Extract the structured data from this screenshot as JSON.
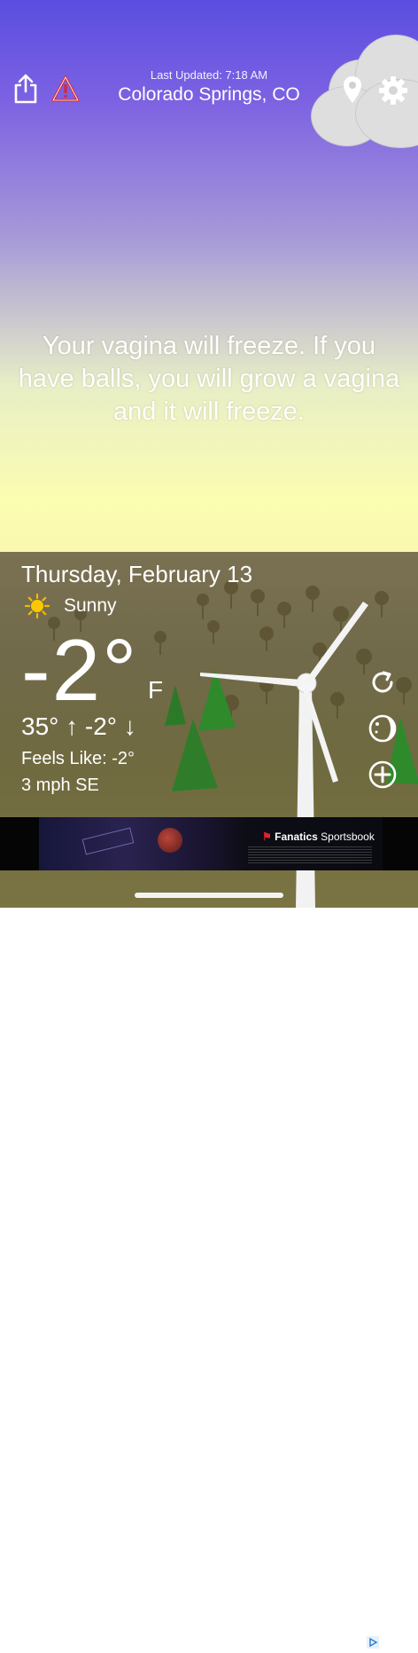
{
  "header": {
    "last_updated": "Last Updated: 7:18 AM",
    "location": "Colorado Springs, CO"
  },
  "icons": {
    "share": "share-icon",
    "alert": "alert-icon",
    "location": "location-pin-icon",
    "settings": "gear-icon",
    "refresh": "refresh-icon",
    "moon": "moon-icon",
    "add": "add-icon"
  },
  "message": "Your vagina will freeze. If you have balls, you will grow a vagina and it will freeze.",
  "forecast": {
    "date": "Thursday, February 13",
    "condition": "Sunny",
    "temperature": "-2°",
    "unit": "F",
    "hi_lo": "35° ↑  -2° ↓",
    "feels_like": "Feels Like: -2°",
    "wind": "3 mph SE"
  },
  "ad": {
    "brand": "Fanatics",
    "brand_suffix": "Sportsbook"
  },
  "colors": {
    "sky_top": "#5a4ee0",
    "sky_bottom": "#fbfdb0",
    "ground": "#706a4a",
    "alert_red": "#e0242a",
    "cloud": "#dedede"
  }
}
